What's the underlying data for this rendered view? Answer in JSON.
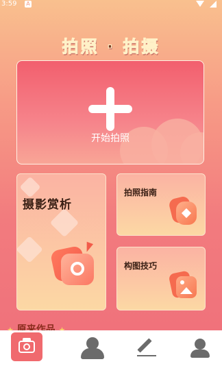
{
  "status_bar": {
    "time": "3:59",
    "notification_letter": "A"
  },
  "page_title": "拍照 · 拍摄",
  "start_card": {
    "label": "开始拍照",
    "icon": "plus-icon"
  },
  "cards": {
    "appreciation": {
      "title": "摄影赏析",
      "icon": "camera-photo-icon"
    },
    "guide": {
      "title": "拍照指南",
      "icon": "guide-icon"
    },
    "composition": {
      "title": "构图技巧",
      "icon": "picture-icon"
    }
  },
  "section_peek": {
    "title": "原来作品",
    "star": "★"
  },
  "tab_bar": {
    "tabs": [
      {
        "icon": "camera-icon",
        "active": true
      },
      {
        "icon": "portrait-icon",
        "active": false
      },
      {
        "icon": "edit-icon",
        "active": false
      },
      {
        "icon": "profile-icon",
        "active": false
      }
    ]
  },
  "colors": {
    "accent": "#f06a6e",
    "title_text": "#7a3a22"
  }
}
